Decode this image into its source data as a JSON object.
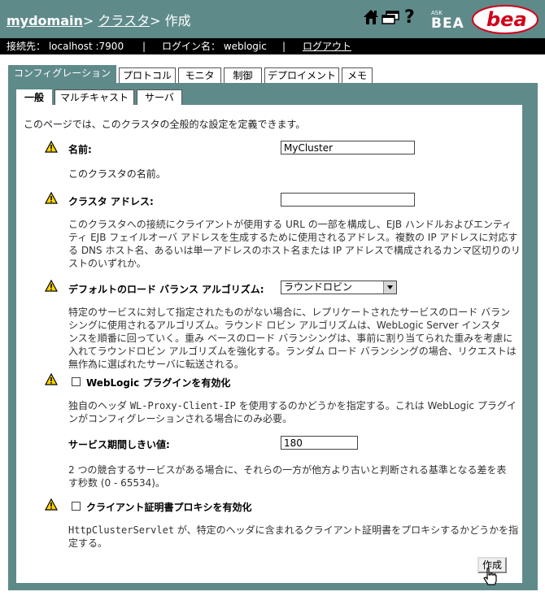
{
  "header": {
    "breadcrumb_domain": "mydomain",
    "sep1": ">",
    "breadcrumb_cluster": "クラスタ",
    "sep2": ">",
    "page_action": "作成",
    "ask_label": "ASK",
    "bea_label": "BEA",
    "brand": "bea",
    "colors": {
      "header_bg": "#5f8a8a",
      "bar_bg": "#000000",
      "logo_red": "#d0021b"
    }
  },
  "status_bar": {
    "connection": "接続先： localhost :7900",
    "sep": "|",
    "login": "ログイン名： weblogic",
    "logout": "ログアウト"
  },
  "tabs": [
    {
      "label": "コンフィグレーション"
    },
    {
      "label": "プロトコル"
    },
    {
      "label": "モニタ"
    },
    {
      "label": "制御"
    },
    {
      "label": "デプロイメント"
    },
    {
      "label": "メモ"
    }
  ],
  "subtabs": [
    {
      "label": "一般"
    },
    {
      "label": "マルチキャスト"
    },
    {
      "label": "サーバ"
    }
  ],
  "form": {
    "intro": "このページでは、このクラスタの全般的な設定を定義できます。",
    "name": {
      "label": "名前:",
      "value": "MyCluster",
      "desc": "このクラスタの名前。"
    },
    "cluster_address": {
      "label": "クラスタ アドレス:",
      "value": "",
      "desc_lines": [
        "このクラスタへの接続にクライアントが使用する URL の一部を構成し、EJB ハンドルおよびエンティ",
        "ティ EJB フェイルオーバ アドレスを生成するために使用されるアドレス。複数の IP アドレスに対応す",
        "る DNS ホスト名、あるいは単一アドレスのホスト名または IP アドレスで構成されるカンマ区切りのリ",
        "ストのいずれか。"
      ]
    },
    "load_balance": {
      "label": "デフォルトのロード バランス アルゴリズム:",
      "selected": "ラウンドロビン",
      "desc_lines": [
        "特定のサービスに対して指定されたものがない場合に、レプリケートされたサービスのロード バラン",
        "シングに使用されるアルゴリズム。ラウンド ロビン アルゴリズムは、WebLogic Server インスタ",
        "ンスを順番に回っていく。重み ベースのロード バランシングは、事前に割り当てられた重みを考慮に",
        "入れてラウンドロビン アルゴリズムを強化する。ランダム ロード バランシングの場合、リクエストは",
        "無作為に選ばれたサーバに転送される。"
      ]
    },
    "weblogic_plugin": {
      "label": "WebLogic プラグインを有効化",
      "checked": false,
      "desc_line1_pre": "独自のヘッダ ",
      "desc_line1_code": "WL-Proxy-Client-IP",
      "desc_line1_post": " を使用するのかどうかを指定する。これは WebLogic プラグイ",
      "desc_line2": "ンがコンフィグレーションされる場合にのみ必要。"
    },
    "service_age": {
      "label": "サービス期間しきい値:",
      "value": "180",
      "desc_lines": [
        "2 つの競合するサービスがある場合に、それらの一方が他方より古いと判断される基準となる差を表",
        "す秒数 (0 - 65534)。"
      ]
    },
    "client_cert_proxy": {
      "label": "クライアント証明書プロキシを有効化",
      "checked": false,
      "desc_line1_code": "HttpClusterServlet",
      "desc_line1_post": " が、特定のヘッダに含まれるクライアント証明書をプロキシするかどうかを指",
      "desc_line2": "定する。"
    },
    "create_button": "作成"
  }
}
